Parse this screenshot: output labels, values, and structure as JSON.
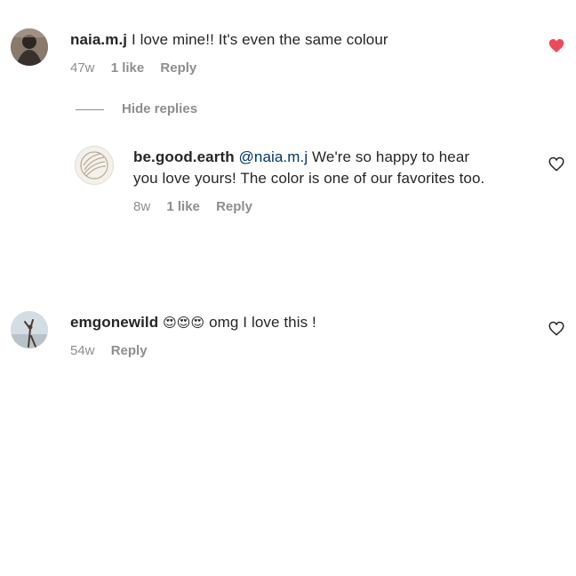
{
  "comments": [
    {
      "username": "naia.m.j",
      "text": "I love mine!! It's even the same colour",
      "age": "47w",
      "likes": "1 like",
      "reply_label": "Reply",
      "liked": true
    },
    {
      "username": "emgonewild",
      "emojis": "😍😍😍",
      "text": "omg I love this !",
      "age": "54w",
      "reply_label": "Reply",
      "liked": false
    }
  ],
  "hide_replies_label": "Hide replies",
  "reply": {
    "username": "be.good.earth",
    "mention": "@naia.m.j",
    "text_line1": "We're so happy to hear",
    "text_line2": "you love yours! The color is one of our favorites too.",
    "age": "8w",
    "likes": "1 like",
    "reply_label": "Reply",
    "liked": false
  },
  "colors": {
    "liked_heart": "#ed4956",
    "meta_gray": "#8e8e8e",
    "mention_blue": "#00376b"
  }
}
